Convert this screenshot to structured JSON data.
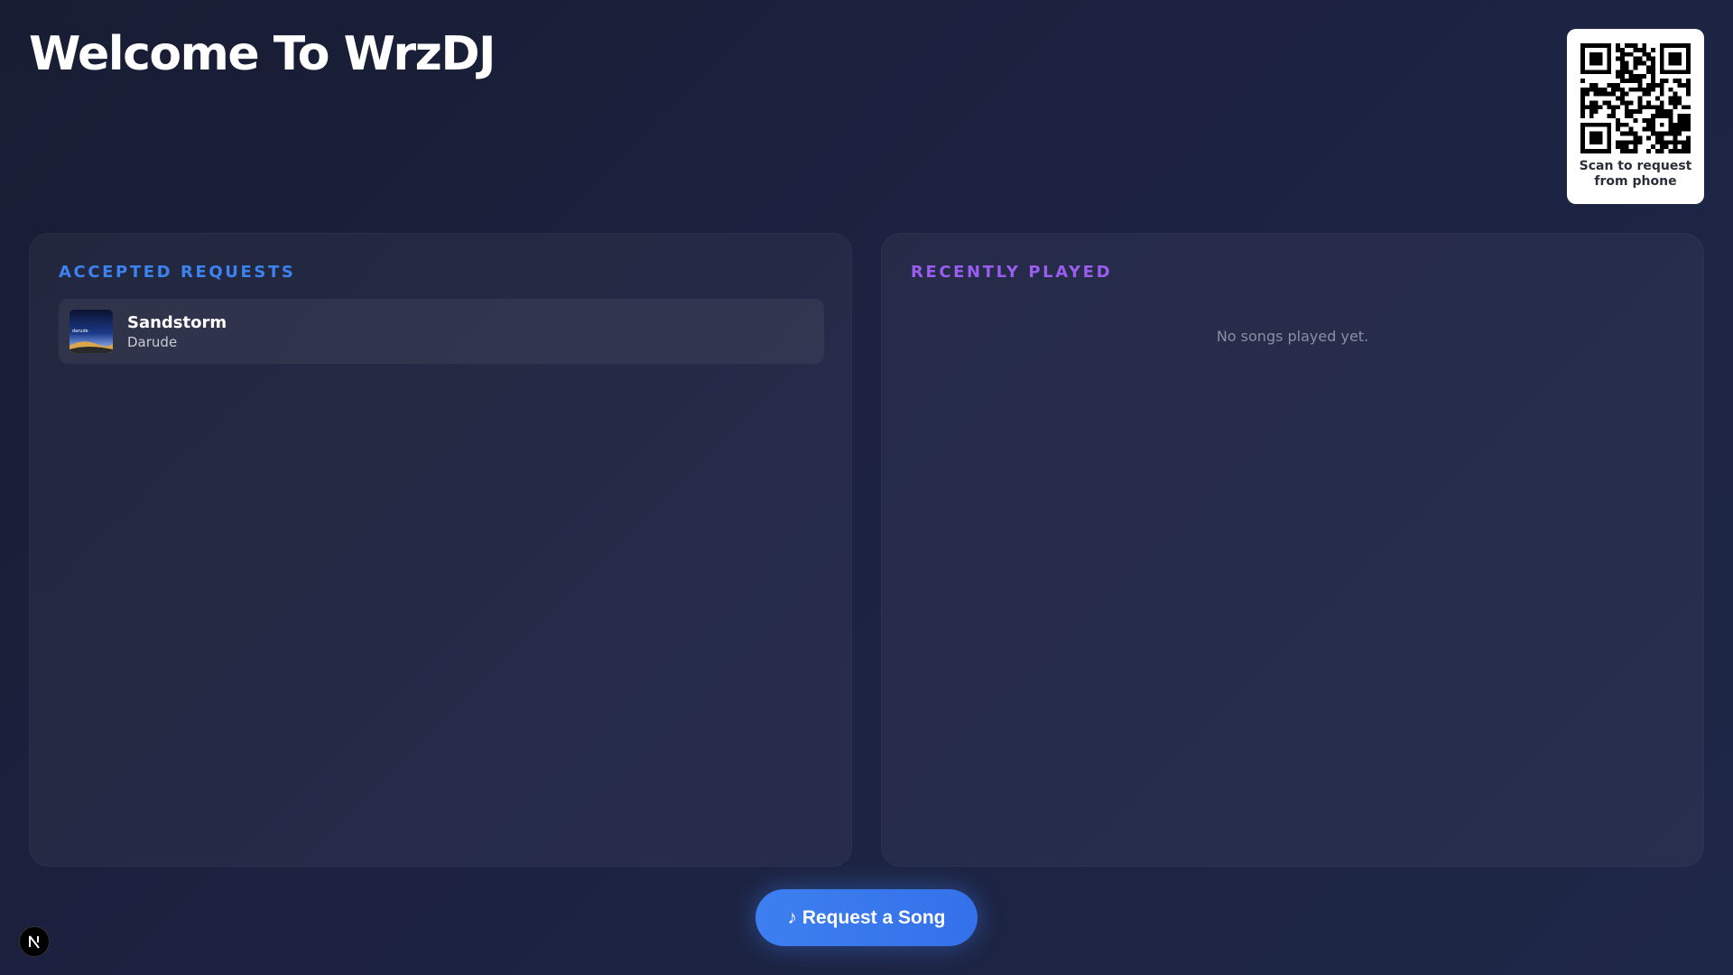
{
  "header": {
    "title": "Welcome To WrzDJ"
  },
  "qr": {
    "caption": "Scan to request from phone"
  },
  "accepted": {
    "heading": "ACCEPTED REQUESTS",
    "items": [
      {
        "title": "Sandstorm",
        "artist": "Darude",
        "art_text": "darude"
      }
    ]
  },
  "recent": {
    "heading": "RECENTLY PLAYED",
    "empty_text": "No songs played yet."
  },
  "request_button": {
    "label": "♪ Request a Song"
  },
  "dev_badge": {
    "letter": "N",
    "icon": "nextjs-icon"
  },
  "colors": {
    "accepted_heading": "#3d82f1",
    "recent_heading": "#9b5cf0",
    "button": "#3d7ff0"
  }
}
